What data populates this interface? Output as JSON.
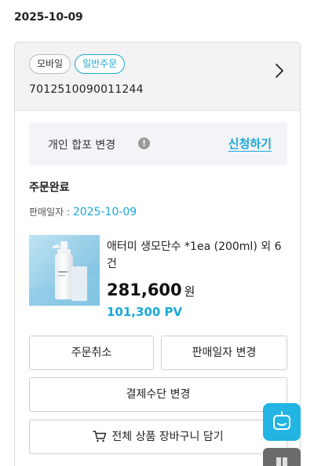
{
  "date_header": "2025-10-09",
  "order": {
    "tags": [
      "모바일",
      "일반주문"
    ],
    "order_number": "7012510090011244"
  },
  "notice": {
    "label": "개인 합포 변경",
    "info_icon": "!",
    "apply_link": "신청하기"
  },
  "status": {
    "title": "주문완료",
    "sale_date_label": "판매일자 : ",
    "sale_date_value": "2025-10-09"
  },
  "product": {
    "name": "애터미 생모단수 *1ea (200ml) 외 6건",
    "price": "281,600",
    "price_unit": "원",
    "pv": "101,300 PV"
  },
  "buttons": {
    "cancel": "주문취소",
    "change_date": "판매일자 변경",
    "change_payment": "결제수단 변경",
    "add_cart": "전체 상품 장바구니 담기"
  },
  "icons": {
    "chevron": "chevron-right-icon",
    "info": "info-icon",
    "cart": "cart-icon",
    "chatbot": "chatbot-icon"
  },
  "colors": {
    "accent": "#18a8d8",
    "chatbot_fab": "#22b4e3",
    "secondary_fab": "#6b6b6b"
  }
}
